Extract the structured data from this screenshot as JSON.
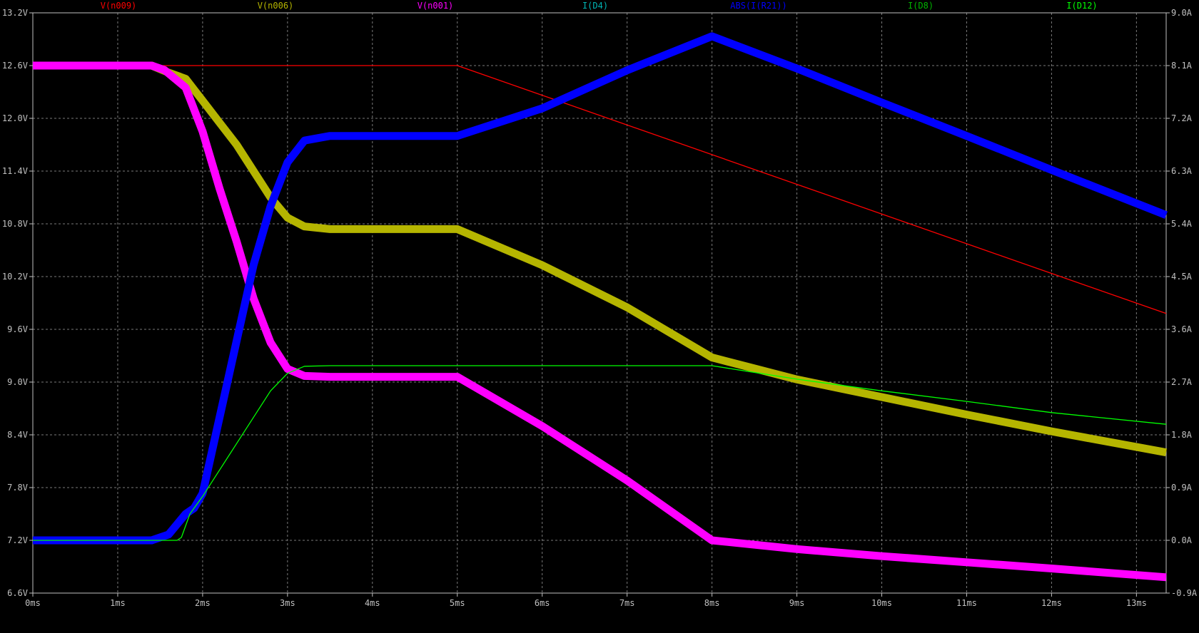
{
  "chart_data": {
    "type": "line",
    "title": "",
    "xlabel": "",
    "ylabel": "",
    "grid": true,
    "legend_placement": "top",
    "x_unit": "ms",
    "xlim": [
      0,
      13.35
    ],
    "ylim_left": [
      6.6,
      13.2
    ],
    "ylim_right": [
      -0.9,
      9.0
    ],
    "x_ticks": [
      "0ms",
      "1ms",
      "2ms",
      "3ms",
      "4ms",
      "5ms",
      "6ms",
      "7ms",
      "8ms",
      "9ms",
      "10ms",
      "11ms",
      "12ms",
      "13ms"
    ],
    "y_ticks_left": [
      "13.2V",
      "12.6V",
      "12.0V",
      "11.4V",
      "10.8V",
      "10.2V",
      "9.6V",
      "9.0V",
      "8.4V",
      "7.8V",
      "7.2V",
      "6.6V"
    ],
    "y_ticks_right": [
      "9.0A",
      "8.1A",
      "7.2A",
      "6.3A",
      "5.4A",
      "4.5A",
      "3.6A",
      "2.7A",
      "1.8A",
      "0.9A",
      "0.0A",
      "-0.9A"
    ],
    "series": [
      {
        "name": "V(n009)",
        "axis": "left",
        "color": "#ff0000",
        "style": "thin",
        "x": [
          0,
          5.0,
          13.35
        ],
        "y": [
          12.6,
          12.6,
          9.78
        ]
      },
      {
        "name": "V(n006)",
        "axis": "left",
        "color": "#b5b500",
        "style": "thick",
        "x": [
          0,
          1.4,
          1.6,
          1.8,
          2.0,
          2.2,
          2.4,
          2.6,
          2.8,
          3.0,
          3.2,
          3.5,
          4.0,
          4.5,
          5.0,
          6.0,
          7.0,
          8.0,
          9.0,
          10.0,
          11.0,
          12.0,
          13.35
        ],
        "y": [
          12.6,
          12.6,
          12.52,
          12.45,
          12.2,
          11.95,
          11.7,
          11.4,
          11.1,
          10.87,
          10.77,
          10.74,
          10.74,
          10.74,
          10.74,
          10.33,
          9.85,
          9.28,
          9.03,
          8.83,
          8.63,
          8.44,
          8.2
        ]
      },
      {
        "name": "V(n001)",
        "axis": "left",
        "color": "#ff00ff",
        "style": "thick",
        "x": [
          0,
          1.4,
          1.55,
          1.8,
          2.0,
          2.2,
          2.4,
          2.6,
          2.8,
          3.0,
          3.2,
          3.5,
          4.0,
          4.5,
          5.0,
          6.0,
          7.0,
          8.0,
          9.0,
          10.0,
          11.0,
          12.0,
          13.35
        ],
        "y": [
          12.6,
          12.6,
          12.55,
          12.35,
          11.85,
          11.2,
          10.6,
          9.95,
          9.45,
          9.15,
          9.07,
          9.06,
          9.06,
          9.06,
          9.06,
          8.5,
          7.88,
          7.2,
          7.1,
          7.02,
          6.95,
          6.88,
          6.78
        ]
      },
      {
        "name": "I(D4)",
        "axis": "right",
        "color": "#00b4b4",
        "style": "thin",
        "x": [],
        "y": []
      },
      {
        "name": "ABS(I(R21))",
        "axis": "right",
        "color": "#0000ff",
        "style": "thick",
        "x": [
          0,
          1.4,
          1.6,
          1.8,
          1.9,
          2.0,
          2.2,
          2.4,
          2.6,
          2.8,
          3.0,
          3.2,
          3.5,
          4.0,
          4.5,
          5.0,
          6.0,
          7.0,
          8.0,
          9.0,
          10.0,
          11.0,
          12.0,
          13.35
        ],
        "y": [
          0,
          0,
          0.1,
          0.45,
          0.55,
          0.8,
          2.1,
          3.4,
          4.7,
          5.7,
          6.45,
          6.82,
          6.9,
          6.9,
          6.9,
          6.9,
          7.37,
          8.02,
          8.6,
          8.05,
          7.47,
          6.9,
          6.32,
          5.55
        ]
      },
      {
        "name": "I(D8)",
        "axis": "right",
        "color": "#00b400",
        "style": "thin",
        "x": [],
        "y": []
      },
      {
        "name": "I(D12)",
        "axis": "right",
        "color": "#00ff00",
        "style": "thin",
        "x": [
          0,
          1.7,
          1.75,
          1.85,
          2.0,
          2.2,
          2.4,
          2.6,
          2.8,
          3.0,
          3.2,
          3.5,
          4.0,
          5.0,
          6.0,
          7.0,
          8.0,
          9.0,
          10.0,
          11.0,
          12.0,
          13.35
        ],
        "y": [
          0,
          0,
          0.05,
          0.45,
          0.75,
          1.2,
          1.65,
          2.1,
          2.55,
          2.85,
          2.97,
          2.98,
          2.98,
          2.98,
          2.98,
          2.98,
          2.98,
          2.75,
          2.55,
          2.37,
          2.18,
          1.98
        ]
      }
    ]
  }
}
